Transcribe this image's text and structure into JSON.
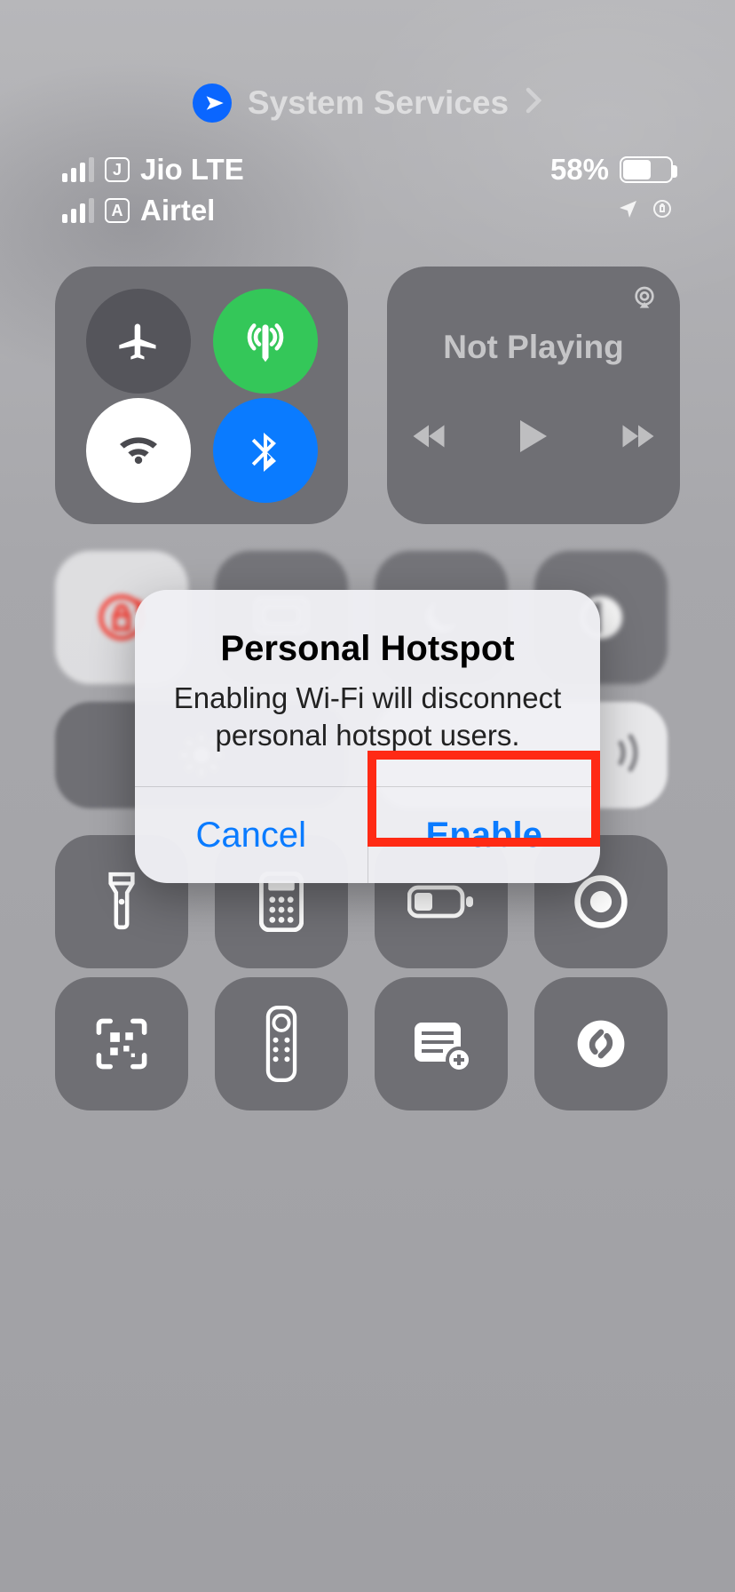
{
  "banner": {
    "label": "System Services"
  },
  "status": {
    "sim1_badge": "J",
    "sim1_label": "Jio LTE",
    "sim2_badge": "A",
    "sim2_label": "Airtel",
    "battery_text": "58%",
    "battery_pct": 58
  },
  "media": {
    "title": "Not Playing"
  },
  "alert": {
    "title": "Personal Hotspot",
    "message": "Enabling Wi-Fi will disconnect personal hotspot users.",
    "cancel": "Cancel",
    "confirm": "Enable"
  },
  "toggles": {
    "airplane": false,
    "cellular": true,
    "wifi": true,
    "bluetooth": true,
    "orientation_lock": true
  },
  "controls": {
    "screen_mirroring": "screen-mirroring",
    "focus": "focus",
    "dark_mode": "dark-mode",
    "flashlight": "flashlight",
    "calculator": "calculator",
    "low_power": "low-power",
    "screen_record": "screen-record",
    "qr_scanner": "qr-scanner",
    "apple_tv_remote": "apple-tv-remote",
    "notes": "quick-note",
    "shazam": "shazam"
  }
}
